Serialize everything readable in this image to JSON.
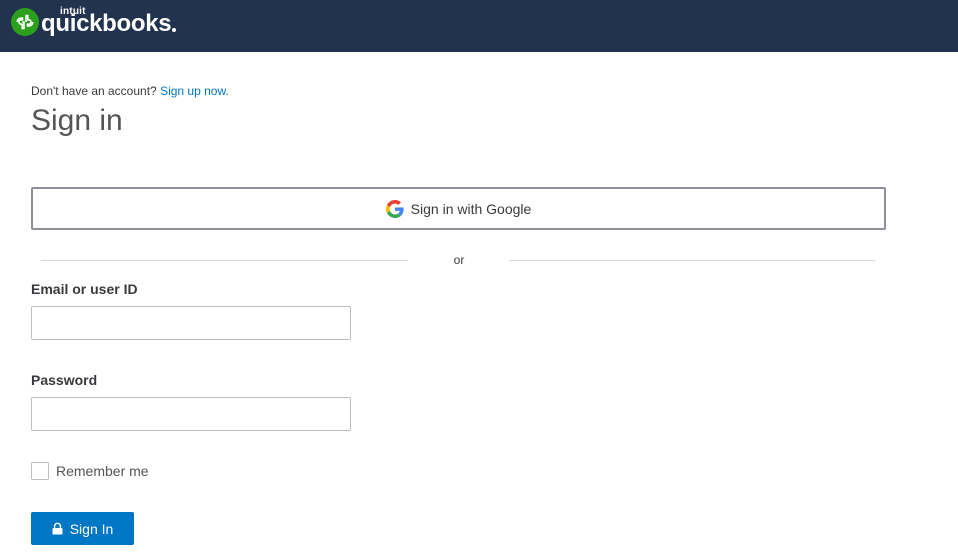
{
  "header": {
    "brand_small": "intuit",
    "brand_name": "quickbooks",
    "brand_color": "#2ca01c",
    "background_color": "#21334f"
  },
  "signup": {
    "prompt": "Don't have an account?",
    "link_text": "Sign up now."
  },
  "page_title": "Sign in",
  "google_button": {
    "label": "Sign in with Google",
    "icon": "google-g-icon"
  },
  "divider_text": "or",
  "email": {
    "label": "Email or user ID",
    "value": ""
  },
  "password": {
    "label": "Password",
    "value": ""
  },
  "remember": {
    "label": "Remember me",
    "checked": false
  },
  "signin_button": {
    "label": "Sign In",
    "icon": "lock-icon",
    "color": "#0077c5"
  },
  "link_color": "#0077c5"
}
